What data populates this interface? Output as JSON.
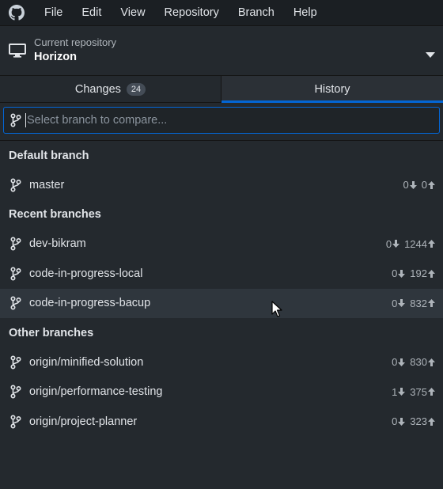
{
  "menubar": {
    "items": [
      "File",
      "Edit",
      "View",
      "Repository",
      "Branch",
      "Help"
    ]
  },
  "repository": {
    "caption": "Current repository",
    "name": "Horizon"
  },
  "tabs": {
    "changes_label": "Changes",
    "changes_count": "24",
    "history_label": "History",
    "active": "History"
  },
  "filter": {
    "placeholder": "Select branch to compare..."
  },
  "groups": [
    {
      "title": "Default branch",
      "branches": [
        {
          "name": "master",
          "behind": "0",
          "ahead": "0"
        }
      ]
    },
    {
      "title": "Recent branches",
      "branches": [
        {
          "name": "dev-bikram",
          "behind": "0",
          "ahead": "1244"
        },
        {
          "name": "code-in-progress-local",
          "behind": "0",
          "ahead": "192"
        },
        {
          "name": "code-in-progress-bacup",
          "behind": "0",
          "ahead": "832",
          "hovered": true
        }
      ]
    },
    {
      "title": "Other branches",
      "branches": [
        {
          "name": "origin/minified-solution",
          "behind": "0",
          "ahead": "830"
        },
        {
          "name": "origin/performance-testing",
          "behind": "1",
          "ahead": "375"
        },
        {
          "name": "origin/project-planner",
          "behind": "0",
          "ahead": "323"
        }
      ]
    }
  ],
  "colors": {
    "accent": "#0366d6",
    "background": "#24292e",
    "hover_row": "#2f363d"
  }
}
